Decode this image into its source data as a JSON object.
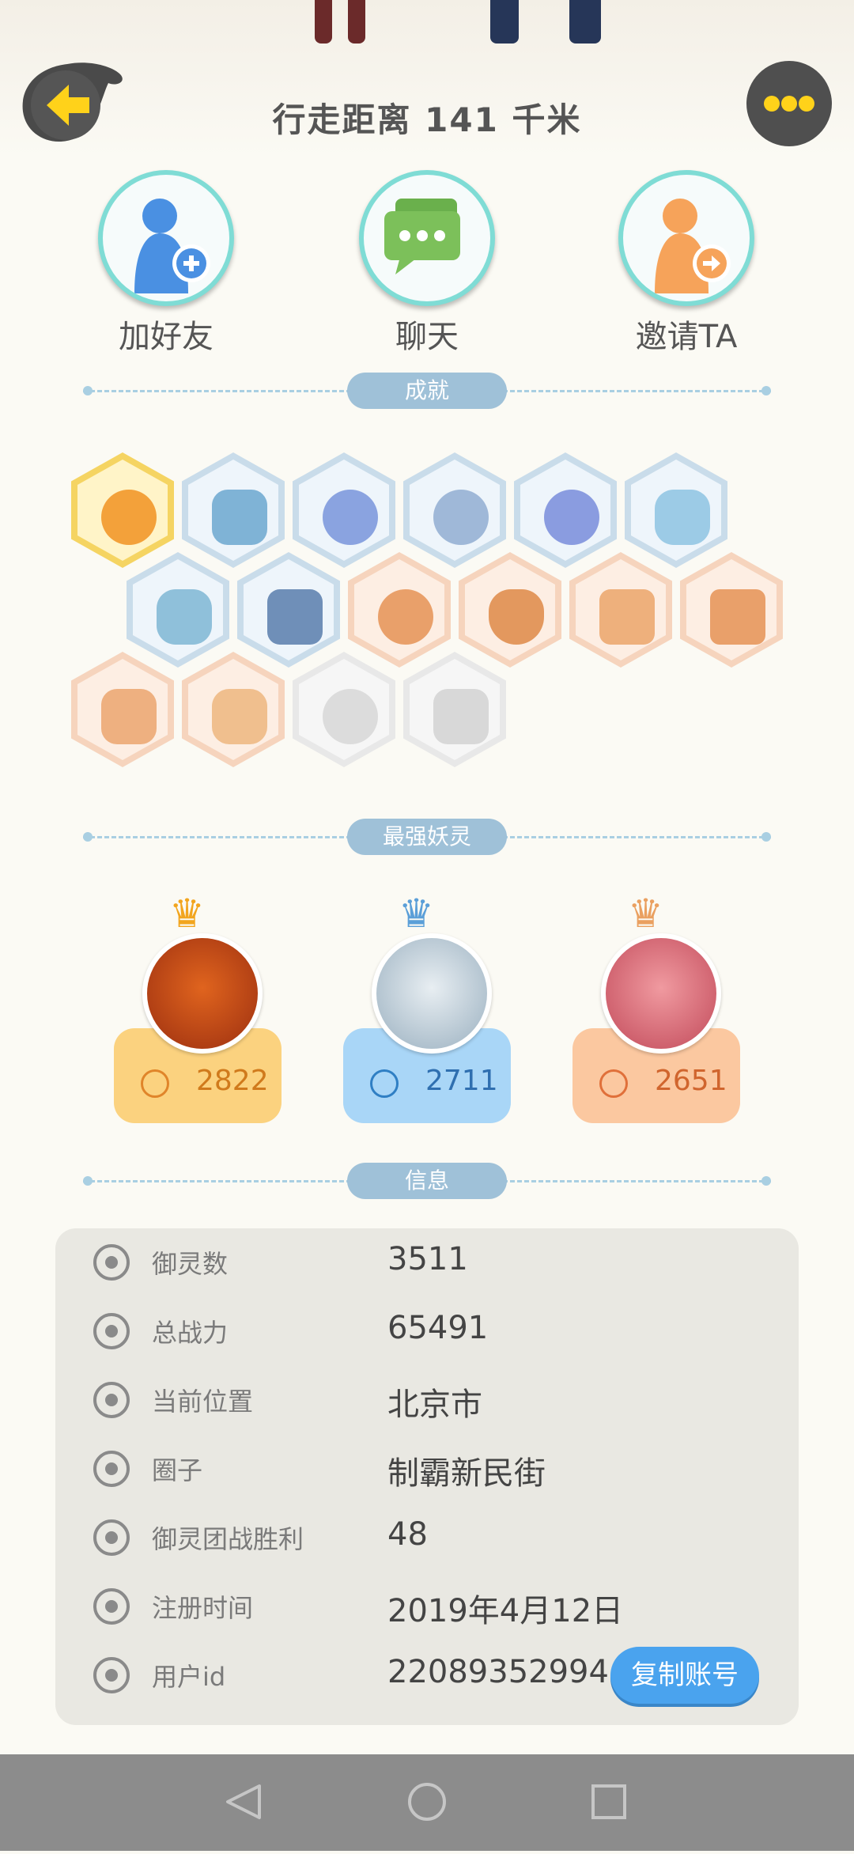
{
  "header": {
    "walk_distance": "行走距离 141 千米",
    "back_icon": "arrow-left-icon",
    "more_icon": "more-dots-icon"
  },
  "actions": [
    {
      "label": "加好友",
      "icon": "add-friend-icon"
    },
    {
      "label": "聊天",
      "icon": "chat-icon"
    },
    {
      "label": "邀请TA",
      "icon": "invite-icon"
    }
  ],
  "sections": {
    "achievements": "成就",
    "strongest": "最强妖灵",
    "info": "信息"
  },
  "strongest_elves": [
    {
      "power": "2822",
      "color": "#fbd27f"
    },
    {
      "power": "2711",
      "color": "#a9d6f7"
    },
    {
      "power": "2651",
      "color": "#fbc8a0"
    }
  ],
  "info": {
    "rows": [
      {
        "key": "御灵数",
        "value": "3511",
        "icon": "spirit-count-icon"
      },
      {
        "key": "总战力",
        "value": "65491",
        "icon": "sword-icon"
      },
      {
        "key": "当前位置",
        "value": "北京市",
        "icon": "location-icon"
      },
      {
        "key": "圈子",
        "value": "制霸新民街",
        "icon": "circle-icon"
      },
      {
        "key": "御灵团战胜利",
        "value": "48",
        "icon": "anchor-icon"
      },
      {
        "key": "注册时间",
        "value": "2019年4月12日",
        "icon": "clock-icon"
      },
      {
        "key": "用户id",
        "value": "22089352994",
        "icon": "id-card-icon"
      }
    ],
    "copy_button": "复制账号"
  },
  "colors": {
    "accent_blue": "#4aa3ee",
    "divider_pill": "#9fc1d8",
    "back_button_yellow": "#ffd21a"
  }
}
